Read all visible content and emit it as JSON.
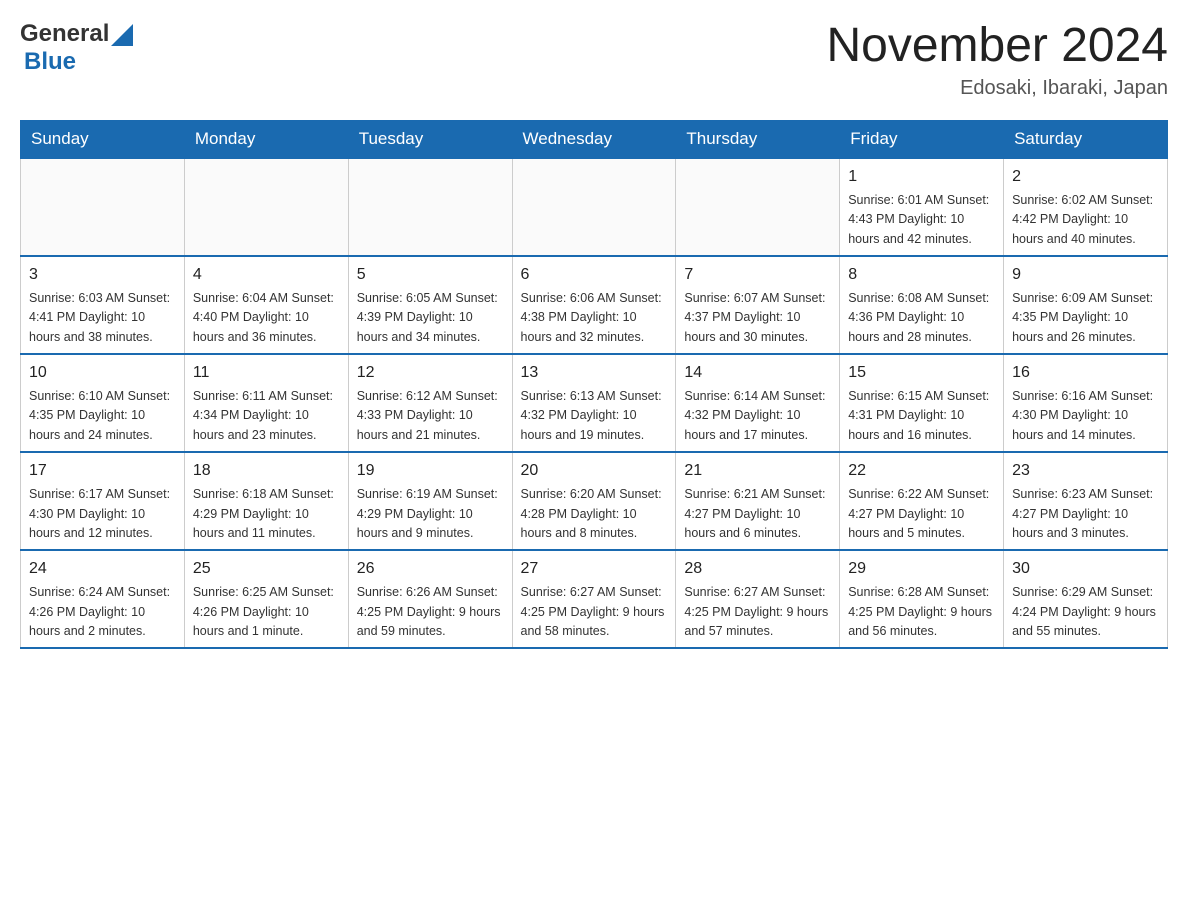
{
  "header": {
    "logo_general": "General",
    "logo_blue": "Blue",
    "month_title": "November 2024",
    "location": "Edosaki, Ibaraki, Japan"
  },
  "days_of_week": [
    "Sunday",
    "Monday",
    "Tuesday",
    "Wednesday",
    "Thursday",
    "Friday",
    "Saturday"
  ],
  "weeks": [
    [
      {
        "day": "",
        "info": ""
      },
      {
        "day": "",
        "info": ""
      },
      {
        "day": "",
        "info": ""
      },
      {
        "day": "",
        "info": ""
      },
      {
        "day": "",
        "info": ""
      },
      {
        "day": "1",
        "info": "Sunrise: 6:01 AM\nSunset: 4:43 PM\nDaylight: 10 hours and 42 minutes."
      },
      {
        "day": "2",
        "info": "Sunrise: 6:02 AM\nSunset: 4:42 PM\nDaylight: 10 hours and 40 minutes."
      }
    ],
    [
      {
        "day": "3",
        "info": "Sunrise: 6:03 AM\nSunset: 4:41 PM\nDaylight: 10 hours and 38 minutes."
      },
      {
        "day": "4",
        "info": "Sunrise: 6:04 AM\nSunset: 4:40 PM\nDaylight: 10 hours and 36 minutes."
      },
      {
        "day": "5",
        "info": "Sunrise: 6:05 AM\nSunset: 4:39 PM\nDaylight: 10 hours and 34 minutes."
      },
      {
        "day": "6",
        "info": "Sunrise: 6:06 AM\nSunset: 4:38 PM\nDaylight: 10 hours and 32 minutes."
      },
      {
        "day": "7",
        "info": "Sunrise: 6:07 AM\nSunset: 4:37 PM\nDaylight: 10 hours and 30 minutes."
      },
      {
        "day": "8",
        "info": "Sunrise: 6:08 AM\nSunset: 4:36 PM\nDaylight: 10 hours and 28 minutes."
      },
      {
        "day": "9",
        "info": "Sunrise: 6:09 AM\nSunset: 4:35 PM\nDaylight: 10 hours and 26 minutes."
      }
    ],
    [
      {
        "day": "10",
        "info": "Sunrise: 6:10 AM\nSunset: 4:35 PM\nDaylight: 10 hours and 24 minutes."
      },
      {
        "day": "11",
        "info": "Sunrise: 6:11 AM\nSunset: 4:34 PM\nDaylight: 10 hours and 23 minutes."
      },
      {
        "day": "12",
        "info": "Sunrise: 6:12 AM\nSunset: 4:33 PM\nDaylight: 10 hours and 21 minutes."
      },
      {
        "day": "13",
        "info": "Sunrise: 6:13 AM\nSunset: 4:32 PM\nDaylight: 10 hours and 19 minutes."
      },
      {
        "day": "14",
        "info": "Sunrise: 6:14 AM\nSunset: 4:32 PM\nDaylight: 10 hours and 17 minutes."
      },
      {
        "day": "15",
        "info": "Sunrise: 6:15 AM\nSunset: 4:31 PM\nDaylight: 10 hours and 16 minutes."
      },
      {
        "day": "16",
        "info": "Sunrise: 6:16 AM\nSunset: 4:30 PM\nDaylight: 10 hours and 14 minutes."
      }
    ],
    [
      {
        "day": "17",
        "info": "Sunrise: 6:17 AM\nSunset: 4:30 PM\nDaylight: 10 hours and 12 minutes."
      },
      {
        "day": "18",
        "info": "Sunrise: 6:18 AM\nSunset: 4:29 PM\nDaylight: 10 hours and 11 minutes."
      },
      {
        "day": "19",
        "info": "Sunrise: 6:19 AM\nSunset: 4:29 PM\nDaylight: 10 hours and 9 minutes."
      },
      {
        "day": "20",
        "info": "Sunrise: 6:20 AM\nSunset: 4:28 PM\nDaylight: 10 hours and 8 minutes."
      },
      {
        "day": "21",
        "info": "Sunrise: 6:21 AM\nSunset: 4:27 PM\nDaylight: 10 hours and 6 minutes."
      },
      {
        "day": "22",
        "info": "Sunrise: 6:22 AM\nSunset: 4:27 PM\nDaylight: 10 hours and 5 minutes."
      },
      {
        "day": "23",
        "info": "Sunrise: 6:23 AM\nSunset: 4:27 PM\nDaylight: 10 hours and 3 minutes."
      }
    ],
    [
      {
        "day": "24",
        "info": "Sunrise: 6:24 AM\nSunset: 4:26 PM\nDaylight: 10 hours and 2 minutes."
      },
      {
        "day": "25",
        "info": "Sunrise: 6:25 AM\nSunset: 4:26 PM\nDaylight: 10 hours and 1 minute."
      },
      {
        "day": "26",
        "info": "Sunrise: 6:26 AM\nSunset: 4:25 PM\nDaylight: 9 hours and 59 minutes."
      },
      {
        "day": "27",
        "info": "Sunrise: 6:27 AM\nSunset: 4:25 PM\nDaylight: 9 hours and 58 minutes."
      },
      {
        "day": "28",
        "info": "Sunrise: 6:27 AM\nSunset: 4:25 PM\nDaylight: 9 hours and 57 minutes."
      },
      {
        "day": "29",
        "info": "Sunrise: 6:28 AM\nSunset: 4:25 PM\nDaylight: 9 hours and 56 minutes."
      },
      {
        "day": "30",
        "info": "Sunrise: 6:29 AM\nSunset: 4:24 PM\nDaylight: 9 hours and 55 minutes."
      }
    ]
  ]
}
